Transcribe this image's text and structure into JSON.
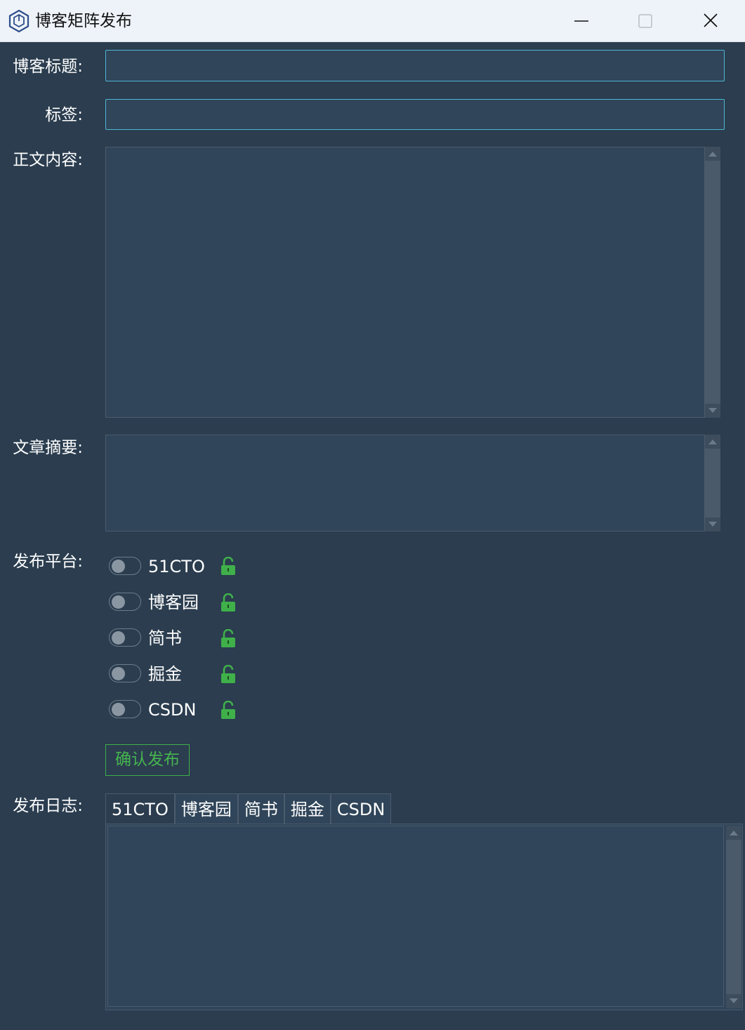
{
  "window": {
    "title": "博客矩阵发布",
    "icon": "hexagon-app-icon",
    "controls": [
      "minimize-icon",
      "maximize-icon",
      "close-icon"
    ]
  },
  "form": {
    "title_label": "博客标题:",
    "title_value": "",
    "tags_label": "标签:",
    "tags_value": "",
    "content_label": "正文内容:",
    "content_value": "",
    "summary_label": "文章摘要:",
    "summary_value": "",
    "platform_label": "发布平台:",
    "platforms": [
      {
        "name": "51CTO",
        "enabled": false,
        "lock": "unlocked-lock-icon"
      },
      {
        "name": "博客园",
        "enabled": false,
        "lock": "unlocked-lock-icon"
      },
      {
        "name": "简书",
        "enabled": false,
        "lock": "unlocked-lock-icon"
      },
      {
        "name": "掘金",
        "enabled": false,
        "lock": "unlocked-lock-icon"
      },
      {
        "name": "CSDN",
        "enabled": false,
        "lock": "unlocked-lock-icon"
      }
    ],
    "confirm_label": "确认发布",
    "log_label": "发布日志:",
    "log_tabs": [
      "51CTO",
      "博客园",
      "简书",
      "掘金",
      "CSDN"
    ],
    "active_log_tab": "51CTO",
    "log_value": ""
  },
  "colors": {
    "background": "#2b3d4f",
    "field": "#304559",
    "input_border": "#4fb5d5",
    "accent_green": "#3fb04a"
  }
}
